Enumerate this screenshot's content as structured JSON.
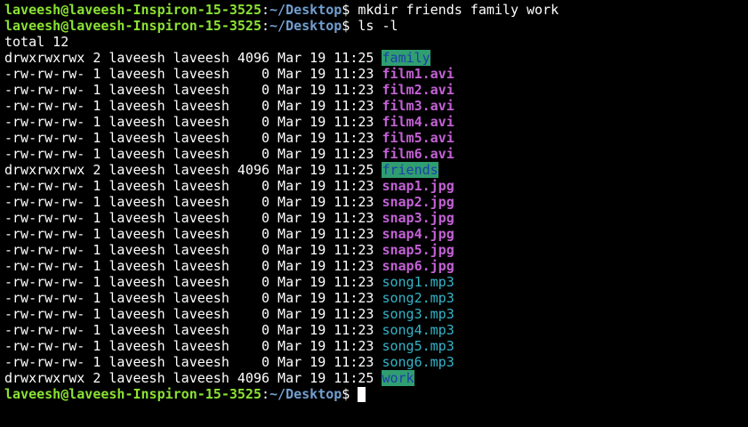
{
  "prompt": {
    "user_host": "laveesh@laveesh-Inspiron-15-3525",
    "colon": ":",
    "path": "~/Desktop",
    "symbol": "$"
  },
  "commands": {
    "first": " mkdir friends family work",
    "second": " ls -l"
  },
  "total": "total 12",
  "rows": [
    {
      "meta": "drwxrwxrwx 2 laveesh laveesh 4096 Mar 19 11:25 ",
      "name": "family",
      "kind": "dir"
    },
    {
      "meta": "-rw-rw-rw- 1 laveesh laveesh    0 Mar 19 11:23 ",
      "name": "film1.avi",
      "kind": "avi"
    },
    {
      "meta": "-rw-rw-rw- 1 laveesh laveesh    0 Mar 19 11:23 ",
      "name": "film2.avi",
      "kind": "avi"
    },
    {
      "meta": "-rw-rw-rw- 1 laveesh laveesh    0 Mar 19 11:23 ",
      "name": "film3.avi",
      "kind": "avi"
    },
    {
      "meta": "-rw-rw-rw- 1 laveesh laveesh    0 Mar 19 11:23 ",
      "name": "film4.avi",
      "kind": "avi"
    },
    {
      "meta": "-rw-rw-rw- 1 laveesh laveesh    0 Mar 19 11:23 ",
      "name": "film5.avi",
      "kind": "avi"
    },
    {
      "meta": "-rw-rw-rw- 1 laveesh laveesh    0 Mar 19 11:23 ",
      "name": "film6.avi",
      "kind": "avi"
    },
    {
      "meta": "drwxrwxrwx 2 laveesh laveesh 4096 Mar 19 11:25 ",
      "name": "friends",
      "kind": "dir"
    },
    {
      "meta": "-rw-rw-rw- 1 laveesh laveesh    0 Mar 19 11:23 ",
      "name": "snap1.jpg",
      "kind": "jpg"
    },
    {
      "meta": "-rw-rw-rw- 1 laveesh laveesh    0 Mar 19 11:23 ",
      "name": "snap2.jpg",
      "kind": "jpg"
    },
    {
      "meta": "-rw-rw-rw- 1 laveesh laveesh    0 Mar 19 11:23 ",
      "name": "snap3.jpg",
      "kind": "jpg"
    },
    {
      "meta": "-rw-rw-rw- 1 laveesh laveesh    0 Mar 19 11:23 ",
      "name": "snap4.jpg",
      "kind": "jpg"
    },
    {
      "meta": "-rw-rw-rw- 1 laveesh laveesh    0 Mar 19 11:23 ",
      "name": "snap5.jpg",
      "kind": "jpg"
    },
    {
      "meta": "-rw-rw-rw- 1 laveesh laveesh    0 Mar 19 11:23 ",
      "name": "snap6.jpg",
      "kind": "jpg"
    },
    {
      "meta": "-rw-rw-rw- 1 laveesh laveesh    0 Mar 19 11:23 ",
      "name": "song1.mp3",
      "kind": "mp3"
    },
    {
      "meta": "-rw-rw-rw- 1 laveesh laveesh    0 Mar 19 11:23 ",
      "name": "song2.mp3",
      "kind": "mp3"
    },
    {
      "meta": "-rw-rw-rw- 1 laveesh laveesh    0 Mar 19 11:23 ",
      "name": "song3.mp3",
      "kind": "mp3"
    },
    {
      "meta": "-rw-rw-rw- 1 laveesh laveesh    0 Mar 19 11:23 ",
      "name": "song4.mp3",
      "kind": "mp3"
    },
    {
      "meta": "-rw-rw-rw- 1 laveesh laveesh    0 Mar 19 11:23 ",
      "name": "song5.mp3",
      "kind": "mp3"
    },
    {
      "meta": "-rw-rw-rw- 1 laveesh laveesh    0 Mar 19 11:23 ",
      "name": "song6.mp3",
      "kind": "mp3"
    },
    {
      "meta": "drwxrwxrwx 2 laveesh laveesh 4096 Mar 19 11:25 ",
      "name": "work",
      "kind": "dir"
    }
  ],
  "colors": {
    "background": "#000000",
    "prompt_user": "#8ae234",
    "prompt_path": "#729fcf",
    "dir_bg": "#2f9e70",
    "dir_fg": "#1e3fa8",
    "media": "#c461d6",
    "audio": "#33b4c8"
  }
}
